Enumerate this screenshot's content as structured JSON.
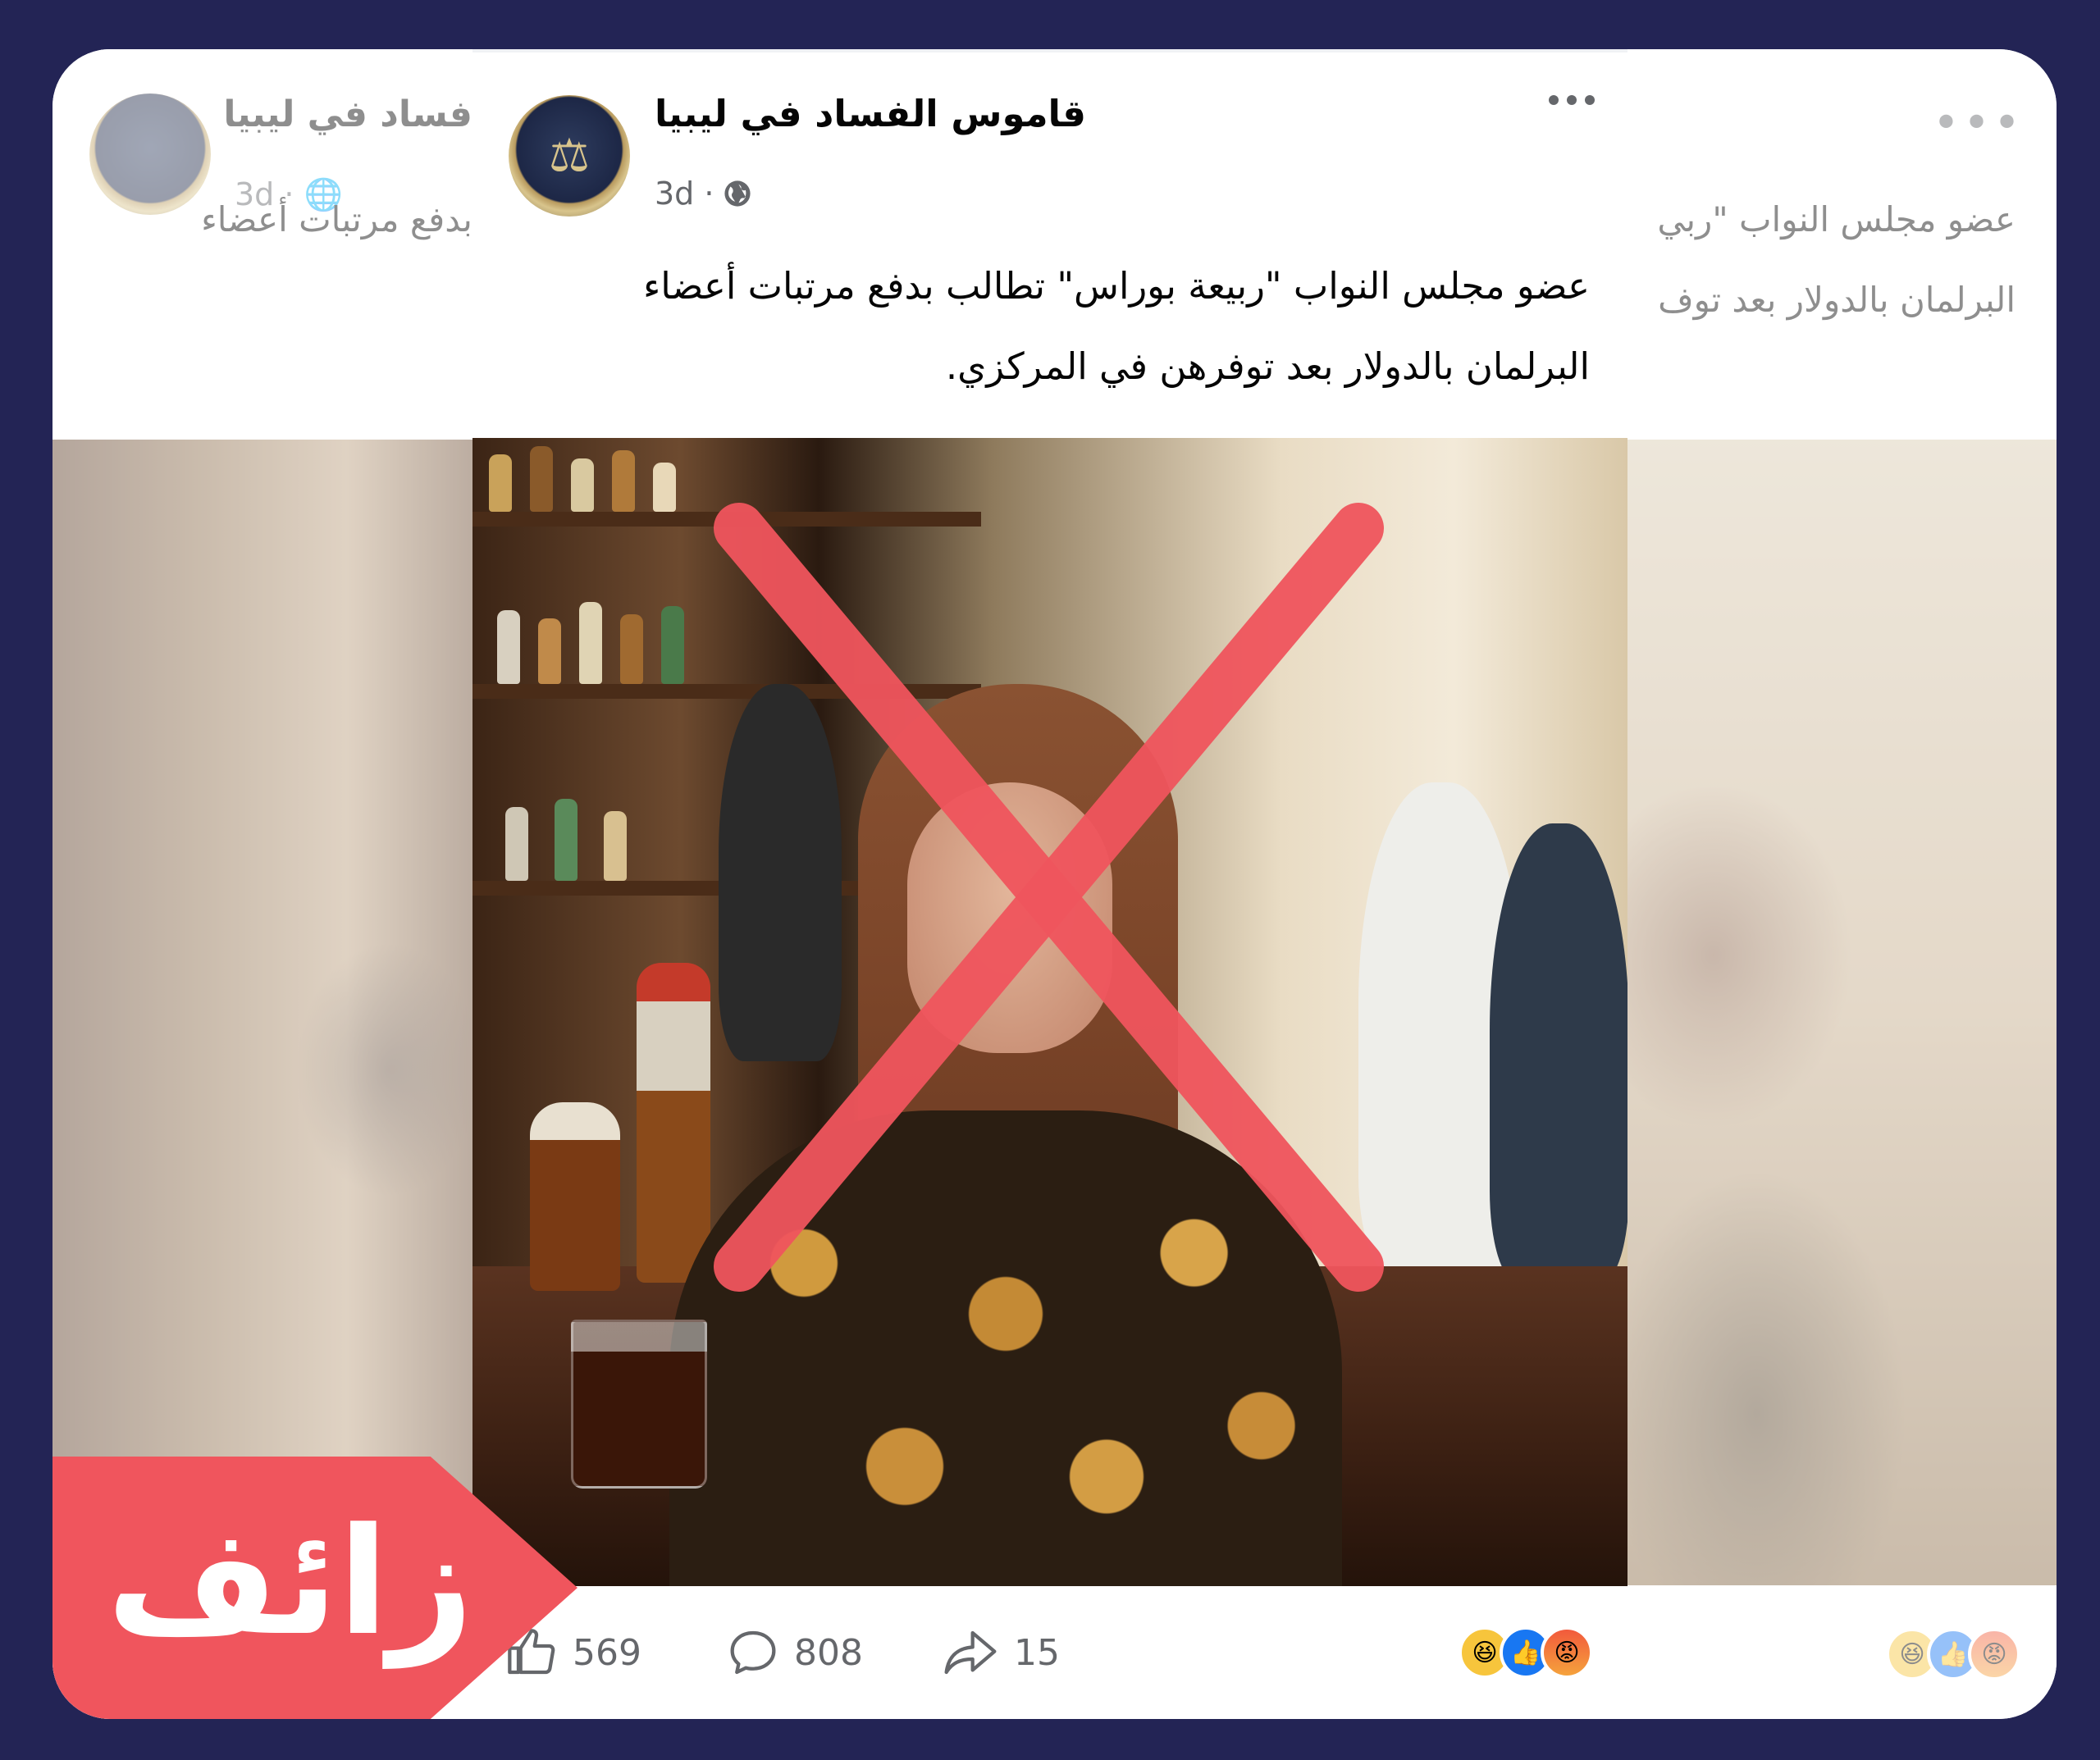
{
  "post": {
    "page_name": "قاموس الفساد في ليبيا",
    "time": "3d",
    "separator": "·",
    "text_line1": "عضو مجلس النواب \"ربيعة بوراس\" تطالب بدفع مرتبات أعضاء",
    "text_line2": "البرلمان بالدولار بعد توفرهن في المركزي.",
    "likes": "569",
    "comments": "808",
    "shares": "15",
    "reactions": [
      "haha",
      "like",
      "angry"
    ],
    "cross_color": "#f0555d"
  },
  "ghost_left": {
    "name_fragment": "فساد في ليبيا",
    "time": "3d",
    "separator": "·",
    "text_line1_fragment": "بدفع مرتبات أعضاء"
  },
  "ghost_right": {
    "text_line1_fragment": "عضو مجلس النواب \"ربي",
    "text_line2_fragment": "البرلمان بالدولار بعد توف"
  },
  "verdict": {
    "label": "زائف",
    "color": "#f0555d"
  },
  "colors": {
    "background": "#232455",
    "frame": "#f0f2f5"
  }
}
